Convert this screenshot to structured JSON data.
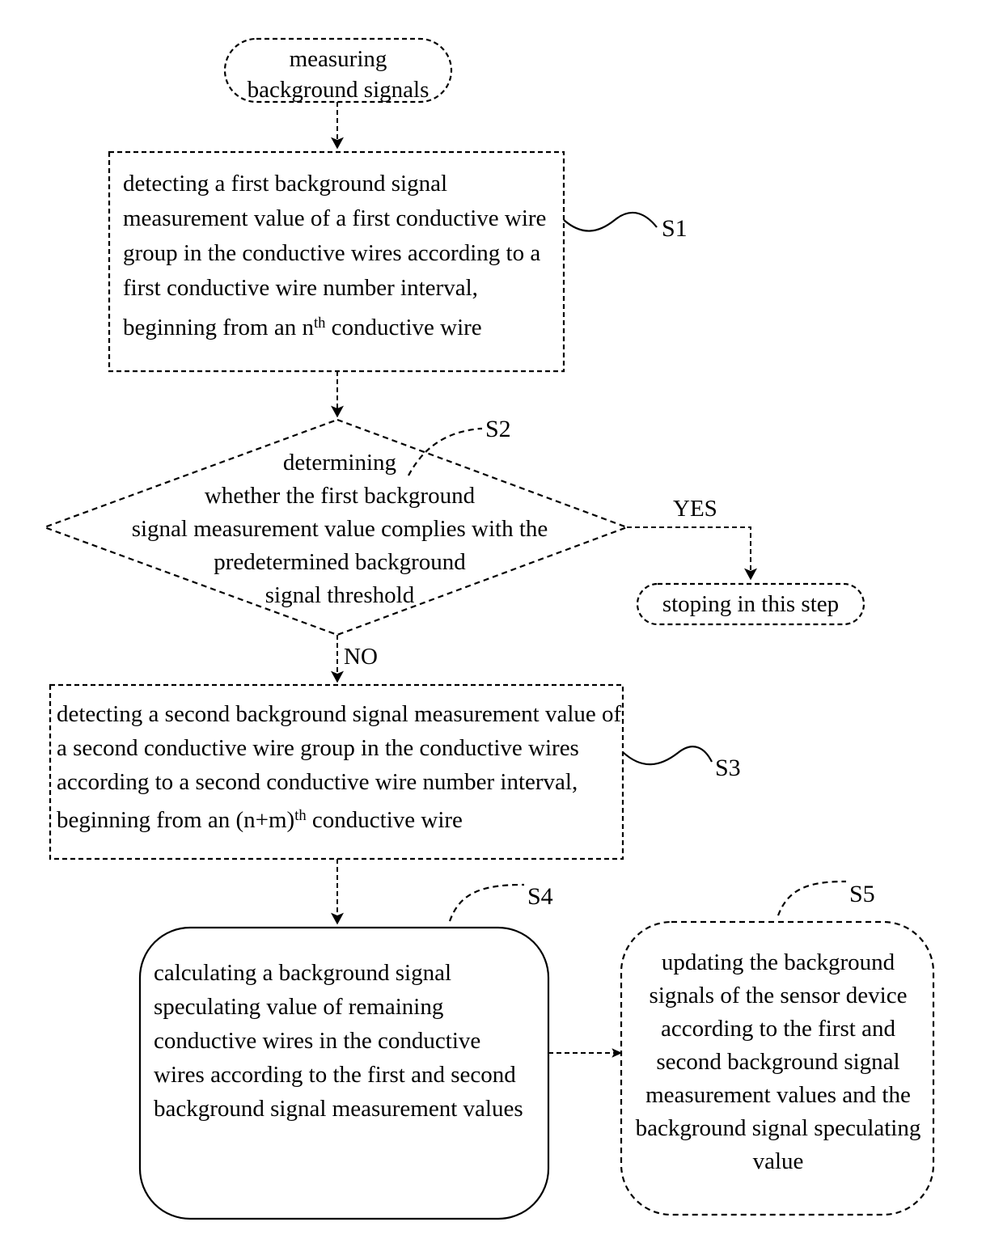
{
  "diagram": {
    "title": "background signal measuring flowchart",
    "stroke_color": "#000000",
    "background_color": "#ffffff"
  },
  "nodes": {
    "start": {
      "shape": "stadium",
      "line_style": "dashed",
      "line1": "measuring",
      "line2": "background signals"
    },
    "s1": {
      "shape": "rectangle",
      "line_style": "dashed",
      "label": "S1",
      "text_a": "detecting a first background signal measurement value of a first conductive wire group in the conductive wires according to a first conductive wire number interval, beginning from an n",
      "text_sup": "th",
      "text_b": " conductive wire"
    },
    "s2": {
      "shape": "diamond",
      "line_style": "dashed",
      "label": "S2",
      "line1": "determining",
      "line2": "whether the first background",
      "line3": "signal measurement value complies with the",
      "line4": "predetermined background",
      "line5": "signal threshold",
      "yes_label": "YES",
      "no_label": "NO"
    },
    "stop": {
      "shape": "stadium",
      "line_style": "dashed",
      "text": "stoping in this step"
    },
    "s3": {
      "shape": "rectangle",
      "line_style": "dashed",
      "label": "S3",
      "text_a": "detecting a second background signal measurement value of a second conductive wire group in the conductive wires according to a second conductive wire number interval, beginning from an (n+m)",
      "text_sup": "th",
      "text_b": " conductive wire"
    },
    "s4": {
      "shape": "rounded-rectangle",
      "line_style": "solid",
      "label": "S4",
      "text": "calculating a background signal speculating value of remaining conductive wires in the conductive wires according to the first and second background signal measurement values"
    },
    "s5": {
      "shape": "rounded-rectangle",
      "line_style": "dashed",
      "label": "S5",
      "text": "updating the background signals of the sensor device according to the first and second background signal measurement values and the background signal speculating value"
    }
  },
  "connectors": [
    {
      "name": "start-to-s1",
      "from": "start",
      "to": "s1",
      "style": "dashed",
      "arrow": true
    },
    {
      "name": "s1-to-s2",
      "from": "s1",
      "to": "s2",
      "style": "dashed",
      "arrow": true
    },
    {
      "name": "s2-yes-to-stop",
      "from": "s2",
      "to": "stop",
      "style": "dashed",
      "arrow": true,
      "label": "YES"
    },
    {
      "name": "s2-no-to-s3",
      "from": "s2",
      "to": "s3",
      "style": "dashed",
      "arrow": true,
      "label": "NO"
    },
    {
      "name": "s3-to-s4",
      "from": "s3",
      "to": "s4",
      "style": "dashed",
      "arrow": true
    },
    {
      "name": "s4-to-s5",
      "from": "s4",
      "to": "s5",
      "style": "dashed",
      "arrow": true
    }
  ]
}
